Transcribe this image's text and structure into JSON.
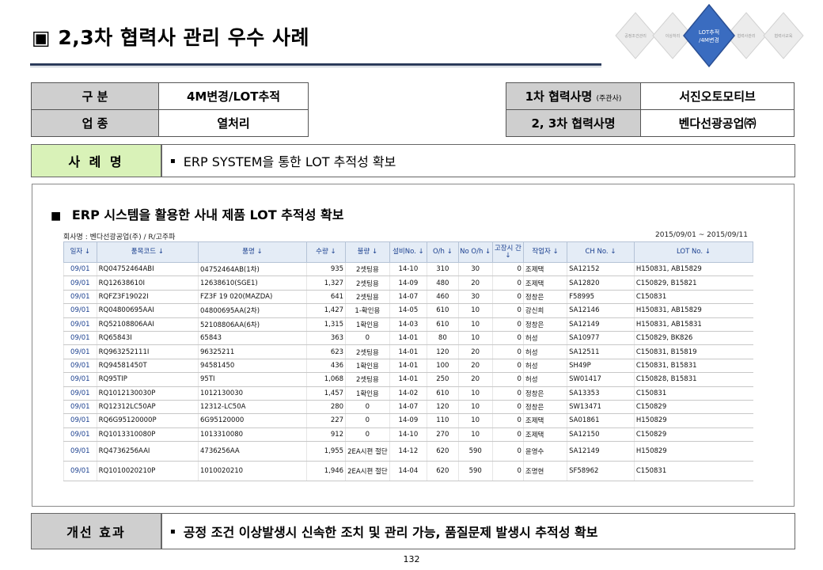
{
  "title": {
    "checkbox": "▣",
    "text": "2,3차 협력사 관리 우수 사례"
  },
  "nav": {
    "items": [
      "공정조건관리",
      "이상처리",
      "LOT추적/4M변경",
      "협력사관리",
      "협력사교육"
    ],
    "active_label": [
      "LOT추적",
      "/4M변경"
    ]
  },
  "info_left": {
    "rows": [
      {
        "label": "구   분",
        "value": "4M변경/LOT추적"
      },
      {
        "label": "업   종",
        "value": "열처리"
      }
    ]
  },
  "info_right": {
    "rows": [
      {
        "label": "1차 협력사명",
        "label_sup": "(주관사)",
        "value": "서진오토모티브"
      },
      {
        "label": "2, 3차 협력사명",
        "label_sup": "",
        "value": "벤다선광공업㈜"
      }
    ]
  },
  "case": {
    "label": "사 례 명",
    "bullet": "▪",
    "text": "ERP SYSTEM을 통한 LOT 추적성 확보"
  },
  "panel": {
    "heading_square": "■",
    "heading": "ERP 시스템을  활용한 사내 제품 LOT 추적성 확보",
    "company": "회사명 : 벤다선광공업(주) / R/고주파",
    "period": "2015/09/01 ~ 2015/09/11",
    "table": {
      "headers": [
        "일자 ↓",
        "품목코드 ↓",
        "품명 ↓",
        "수량 ↓",
        "불량 ↓",
        "설비No. ↓",
        "O/h ↓",
        "No O/h ↓",
        "고장시 간 ↓",
        "작업자 ↓",
        "CH No. ↓",
        "LOT No. ↓"
      ],
      "rows": [
        [
          "09/01",
          "RQ04752464ABI",
          "04752464AB(1차)",
          "935",
          "2셋팅용",
          "14-10",
          "310",
          "30",
          "0",
          "조제택",
          "SA12152",
          "H150831, AB15829"
        ],
        [
          "09/01",
          "RQ12638610I",
          "12638610(SGE1)",
          "1,327",
          "2셋팅용",
          "14-09",
          "480",
          "20",
          "0",
          "조제택",
          "SA12820",
          "C150829, B15821"
        ],
        [
          "09/01",
          "RQFZ3F19022I",
          "FZ3F 19 020(MAZDA)",
          "641",
          "2셋팅용",
          "14-07",
          "460",
          "30",
          "0",
          "정창은",
          "F58995",
          "C150831"
        ],
        [
          "09/01",
          "RQ04800695AAI",
          "04800695AA(2차)",
          "1,427",
          "1-확인용",
          "14-05",
          "610",
          "10",
          "0",
          "강신희",
          "SA12146",
          "H150831, AB15829"
        ],
        [
          "09/01",
          "RQ52108806AAI",
          "52108806AA(6차)",
          "1,315",
          "1확인용",
          "14-03",
          "610",
          "10",
          "0",
          "정창은",
          "SA12149",
          "H150831, AB15831"
        ],
        [
          "09/01",
          "RQ65843I",
          "65843",
          "363",
          "0",
          "14-01",
          "80",
          "10",
          "0",
          "허성",
          "SA10977",
          "C150829, BK826"
        ],
        [
          "09/01",
          "RQ963252111I",
          "96325211",
          "623",
          "2셋팅용",
          "14-01",
          "120",
          "20",
          "0",
          "허성",
          "SA12511",
          "C150831, B15819"
        ],
        [
          "09/01",
          "RQ94581450T",
          "94581450",
          "436",
          "1확인용",
          "14-01",
          "100",
          "20",
          "0",
          "허성",
          "SH49P",
          "C150831, B15831"
        ],
        [
          "09/01",
          "RQ95TIP",
          "95TI",
          "1,068",
          "2셋팅용",
          "14-01",
          "250",
          "20",
          "0",
          "허성",
          "SW01417",
          "C150828, B15831"
        ],
        [
          "09/01",
          "RQ1012130030P",
          "1012130030",
          "1,457",
          "1확인용",
          "14-02",
          "610",
          "10",
          "0",
          "정창은",
          "SA13353",
          "C150831"
        ],
        [
          "09/01",
          "RQ12312LC50AP",
          "12312-LC50A",
          "280",
          "0",
          "14-07",
          "120",
          "10",
          "0",
          "정창은",
          "SW13471",
          "C150829"
        ],
        [
          "09/01",
          "RQ6G95120000P",
          "6G95120000",
          "227",
          "0",
          "14-09",
          "110",
          "10",
          "0",
          "조제택",
          "SA01861",
          "H150829"
        ],
        [
          "09/01",
          "RQ1013310080P",
          "1013310080",
          "912",
          "0",
          "14-10",
          "270",
          "10",
          "0",
          "조제택",
          "SA12150",
          "C150829"
        ],
        [
          "09/01",
          "RQ4736256AAI",
          "4736256AA",
          "1,955",
          "2EA시편 절단",
          "14-12",
          "620",
          "590",
          "0",
          "윤영수",
          "SA12149",
          "H150829"
        ],
        [
          "09/01",
          "RQ1010020210P",
          "1010020210",
          "1,946",
          "2EA시편 절단",
          "14-04",
          "620",
          "590",
          "0",
          "조명현",
          "SF58962",
          "C150831"
        ]
      ]
    }
  },
  "effect": {
    "label": "개선 효과",
    "bullet": "▪",
    "text": "공정 조건 이상발생시 신속한 조치 및 관리 가능, 품질문제 발생시 추적성  확보"
  },
  "page_number": "132",
  "colors": {
    "accent": "#3a6cc0",
    "green_label": "#d9f2b8",
    "gray_label": "#cfcfcf",
    "grid_header": "#e4ecf6"
  }
}
